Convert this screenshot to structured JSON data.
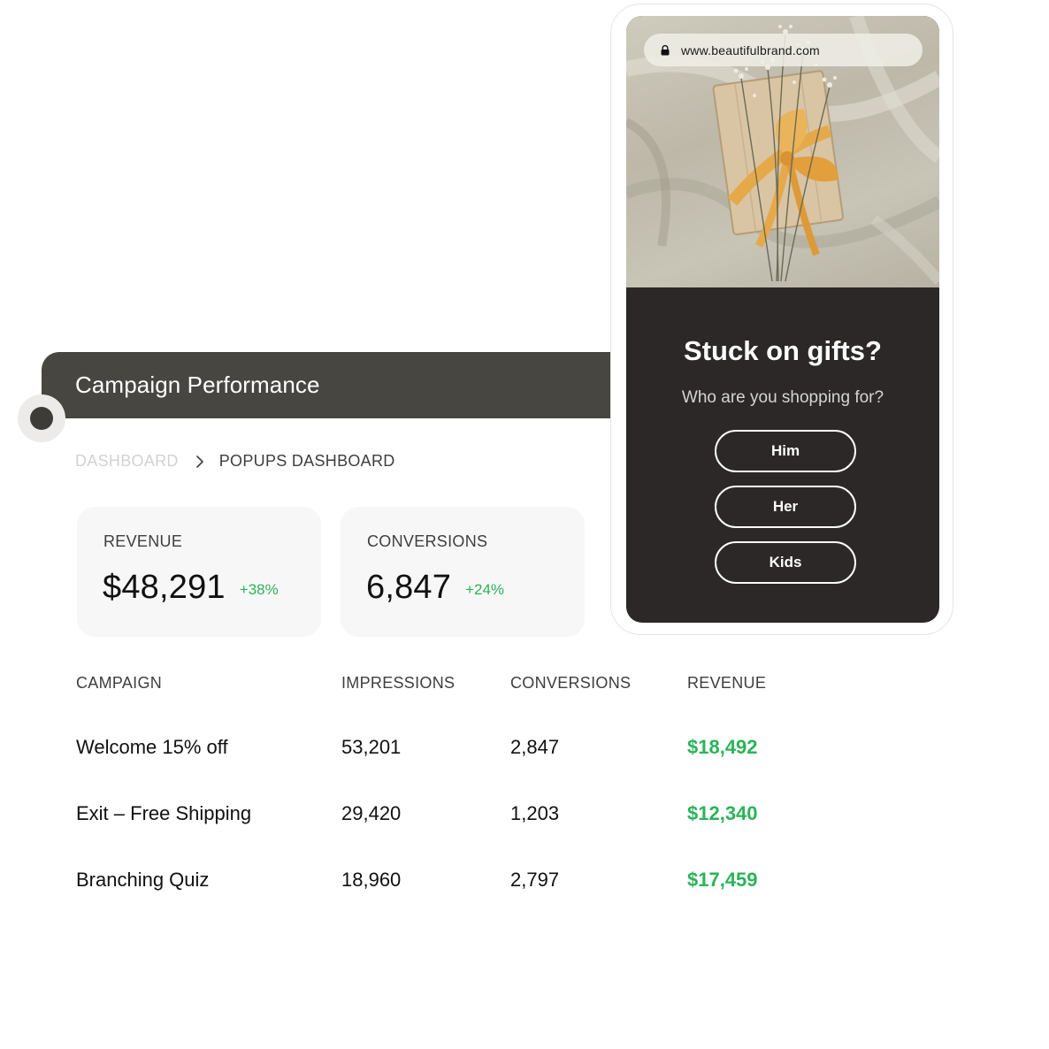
{
  "header": {
    "title": "Campaign Performance"
  },
  "breadcrumb": {
    "items": [
      "DASHBOARD",
      "POPUPS DASHBOARD"
    ]
  },
  "stats": [
    {
      "label": "REVENUE",
      "value": "$48,291",
      "change": "+38%"
    },
    {
      "label": "CONVERSIONS",
      "value": "6,847",
      "change": "+24%"
    }
  ],
  "table": {
    "columns": [
      "CAMPAIGN",
      "IMPRESSIONS",
      "CONVERSIONS",
      "REVENUE"
    ],
    "rows": [
      {
        "campaign": "Welcome 15% off",
        "impressions": "53,201",
        "conversions": "2,847",
        "revenue": "$18,492"
      },
      {
        "campaign": "Exit – Free Shipping",
        "impressions": "29,420",
        "conversions": "1,203",
        "revenue": "$12,340"
      },
      {
        "campaign": "Branching Quiz",
        "impressions": "18,960",
        "conversions": "2,797",
        "revenue": "$17,459"
      }
    ]
  },
  "popup": {
    "url": "www.beautifulbrand.com",
    "title": "Stuck on gifts?",
    "subtitle": "Who are you shopping for?",
    "options": [
      "Him",
      "Her",
      "Kids"
    ]
  },
  "colors": {
    "header_bg": "#474640",
    "positive_green": "#2bb35a",
    "popup_bg": "#2b2827",
    "card_bg": "#f7f7f7"
  },
  "icons": [
    "chevron-right-icon",
    "lock-icon",
    "status-dot-icon"
  ]
}
